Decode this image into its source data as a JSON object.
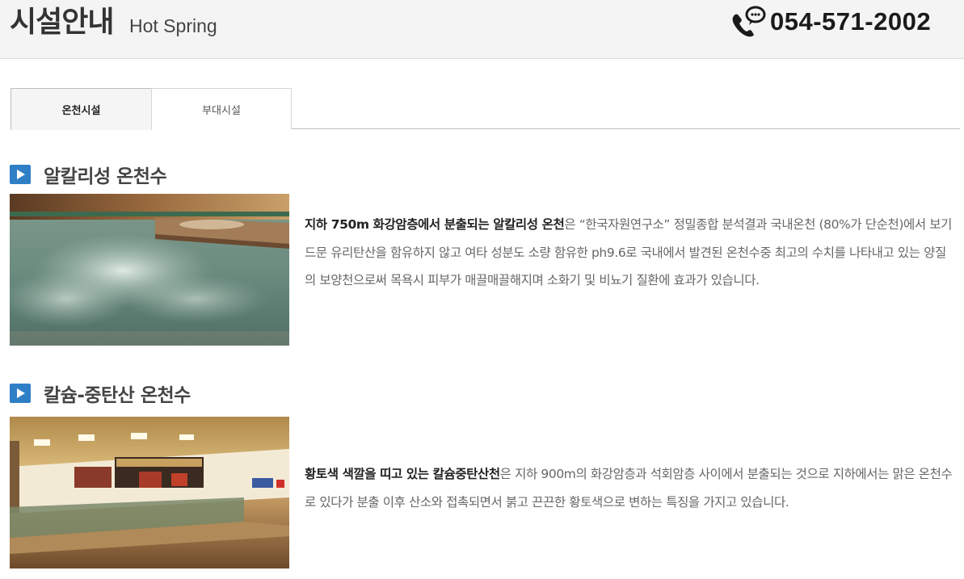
{
  "header": {
    "title": "시설안내",
    "subtitle": "Hot Spring",
    "phone": "054-571-2002",
    "phone_icon": "phone-chat-icon"
  },
  "tabs": [
    {
      "label": "온천시설",
      "active": true
    },
    {
      "label": "부대시설",
      "active": false
    }
  ],
  "sections": [
    {
      "title": "알칼리성 온천수",
      "icon": "play-icon",
      "photo": "indoor-hot-spring-pool-photo",
      "desc_bold": "지하 750m 화강암층에서 분출되는 알칼리성 온천",
      "desc_rest": "은 “한국자원연구소” 정밀종합 분석결과 국내온천 (80%가 단순천)에서 보기 드문 유리탄산을 함유하지 않고 여타 성분도 소량 함유한 ph9.6로 국내에서 발견된 온천수중 최고의 수치를 나타내고 있는 양질의 보양천으로써 목욕시 피부가 매끌매끌해지며 소화기 및 비뇨기 질환에 효과가 있습니다."
    },
    {
      "title": "칼슘-중탄산 온천수",
      "icon": "play-icon",
      "photo": "calcium-spa-hall-photo",
      "desc_bold1": "황토색 색깔을 띠고 있는 ",
      "desc_bold2": "칼슘중탄산천",
      "desc_rest": "은 지하 900m의 화강암층과 석회암층 사이에서 분출되는 것으로 지하에서는 맑은 온천수로 있다가 분출 이후 산소와 접촉되면서 붉고 끈끈한 황토색으로 변하는 특징을 가지고 있습니다."
    }
  ],
  "colors": {
    "accent": "#2f7fc6",
    "header_bg": "#f4f4f4"
  }
}
